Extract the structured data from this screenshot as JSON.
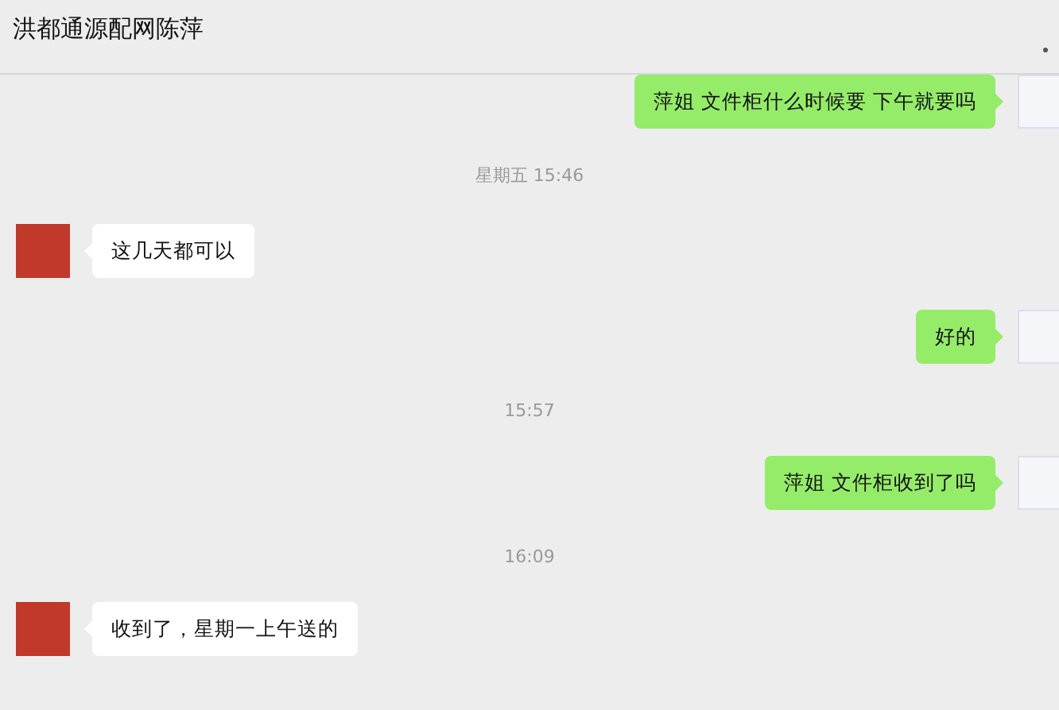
{
  "header": {
    "title": "洪都通源配网陈萍"
  },
  "messages": [
    {
      "kind": "outgoing",
      "text": "萍姐 文件柜什么时候要 下午就要吗"
    },
    {
      "kind": "time",
      "text": "星期五 15:46"
    },
    {
      "kind": "incoming",
      "text": "这几天都可以"
    },
    {
      "kind": "outgoing",
      "text": "好的"
    },
    {
      "kind": "time",
      "text": "15:57"
    },
    {
      "kind": "outgoing",
      "text": "萍姐 文件柜收到了吗"
    },
    {
      "kind": "time",
      "text": "16:09"
    },
    {
      "kind": "incoming",
      "text": "收到了，星期一上午送的"
    }
  ]
}
